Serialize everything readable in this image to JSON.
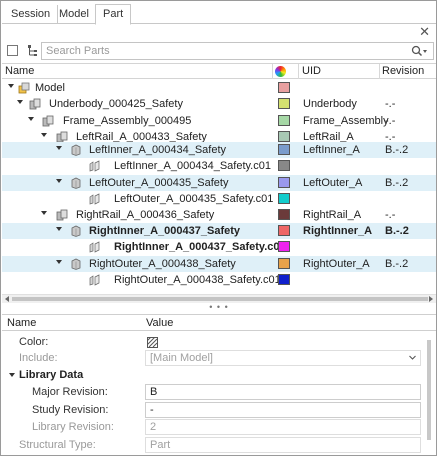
{
  "tabs": [
    {
      "label": "Session"
    },
    {
      "label": "Model"
    },
    {
      "label": "Part"
    }
  ],
  "toolbar": {
    "search_placeholder": "Search Parts"
  },
  "tree": {
    "columns": {
      "name": "Name",
      "uid": "UID",
      "revision": "Revision"
    },
    "rows": [
      {
        "name": "Model",
        "uid": "",
        "revision": "",
        "color": "#e8a0a0",
        "icon": "model-icon"
      },
      {
        "name": "Underbody_000425_Safety",
        "uid": "Underbody",
        "revision": "-.-",
        "color": "#d4e070",
        "icon": "assembly-icon"
      },
      {
        "name": "Frame_Assembly_000495",
        "uid": "Frame_Assembly",
        "revision": "-.-",
        "color": "#a6d8a6",
        "icon": "assembly-icon"
      },
      {
        "name": "LeftRail_A_000433_Safety",
        "uid": "LeftRail_A",
        "revision": "-.-",
        "color": "#a8c8b4",
        "icon": "assembly-icon"
      },
      {
        "name": "LeftInner_A_000434_Safety",
        "uid": "LeftInner_A",
        "revision": "B.-.2",
        "color": "#7a9ccc",
        "icon": "part-icon"
      },
      {
        "name": "LeftInner_A_000434_Safety.c01",
        "uid": "",
        "revision": "",
        "color": "#888888",
        "icon": "component-icon"
      },
      {
        "name": "LeftOuter_A_000435_Safety",
        "uid": "LeftOuter_A",
        "revision": "B.-.2",
        "color": "#9999ee",
        "icon": "part-icon"
      },
      {
        "name": "LeftOuter_A_000435_Safety.c01",
        "uid": "",
        "revision": "",
        "color": "#11cccc",
        "icon": "component-icon"
      },
      {
        "name": "RightRail_A_000436_Safety",
        "uid": "RightRail_A",
        "revision": "-.-",
        "color": "#6b3a3a",
        "icon": "assembly-icon"
      },
      {
        "name": "RightInner_A_000437_Safety",
        "uid": "RightInner_A",
        "revision": "B.-.2",
        "color": "#ee6666",
        "icon": "part-icon"
      },
      {
        "name": "RightInner_A_000437_Safety.c01",
        "uid": "",
        "revision": "",
        "color": "#ee22ee",
        "icon": "component-icon"
      },
      {
        "name": "RightOuter_A_000438_Safety",
        "uid": "RightOuter_A",
        "revision": "B.-.2",
        "color": "#e8a24a",
        "icon": "part-icon"
      },
      {
        "name": "RightOuter_A_000438_Safety.c01",
        "uid": "",
        "revision": "",
        "color": "#1020cc",
        "icon": "component-icon"
      }
    ]
  },
  "props": {
    "columns": {
      "name": "Name",
      "value": "Value"
    },
    "color_label": "Color:",
    "include_label": "Include:",
    "include_value": "[Main Model]",
    "section_label": "Library Data",
    "major_label": "Major Revision:",
    "major_value": "B",
    "study_label": "Study Revision:",
    "study_value": "-",
    "library_label": "Library Revision:",
    "library_value": "2",
    "structural_label": "Structural Type:",
    "structural_value": "Part"
  },
  "colors": {
    "highlight_row": "#dff0f8",
    "border": "#9a9a9a"
  }
}
